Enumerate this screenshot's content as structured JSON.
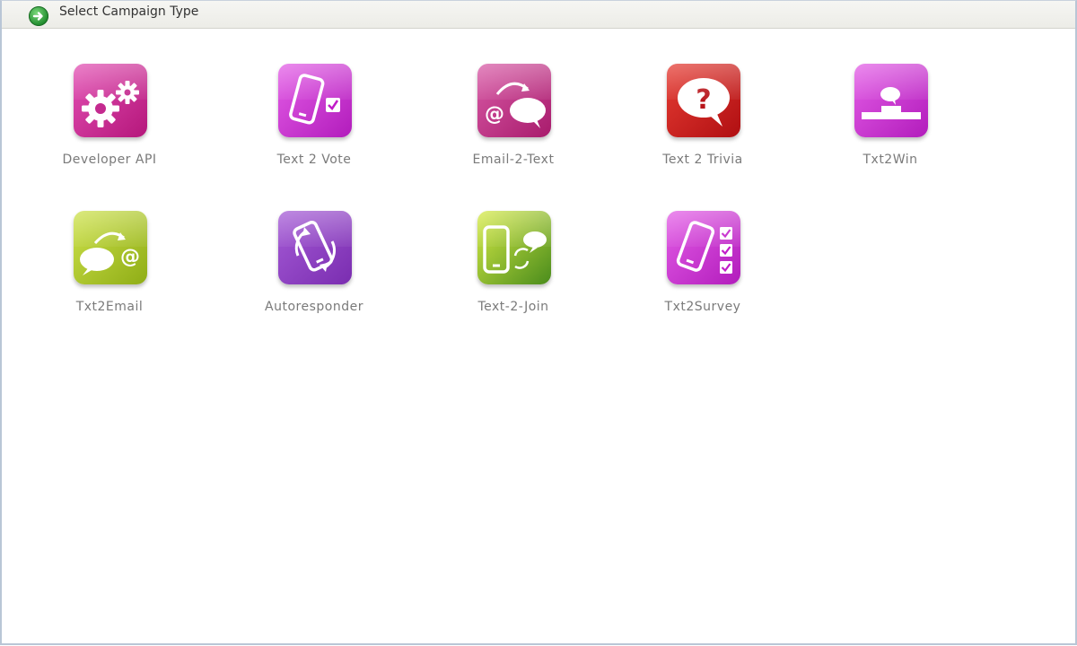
{
  "header": {
    "title": "Select Campaign Type",
    "icon": "arrow-right-circle-icon"
  },
  "tiles": [
    {
      "label": "Developer API",
      "icon": "gears-icon",
      "color": "#c92a93"
    },
    {
      "label": "Text 2 Vote",
      "icon": "phone-check-icon",
      "color": "#cc2ad2"
    },
    {
      "label": "Email-2-Text",
      "icon": "email-to-chat-icon",
      "color": "#c03a8b"
    },
    {
      "label": "Text 2 Trivia",
      "icon": "question-bubble-icon",
      "color": "#cf2420"
    },
    {
      "label": "Txt2Win",
      "icon": "podium-icon",
      "color": "#cc2ad2"
    },
    {
      "label": "Txt2Email",
      "icon": "chat-to-email-icon",
      "color": "#aec830"
    },
    {
      "label": "Autoresponder",
      "icon": "phone-refresh-icon",
      "color": "#8d3fc3"
    },
    {
      "label": "Text-2-Join",
      "icon": "phone-chat-join-icon",
      "color": "#7fb42a"
    },
    {
      "label": "Txt2Survey",
      "icon": "phone-checklist-icon",
      "color": "#cc2ad2"
    }
  ]
}
